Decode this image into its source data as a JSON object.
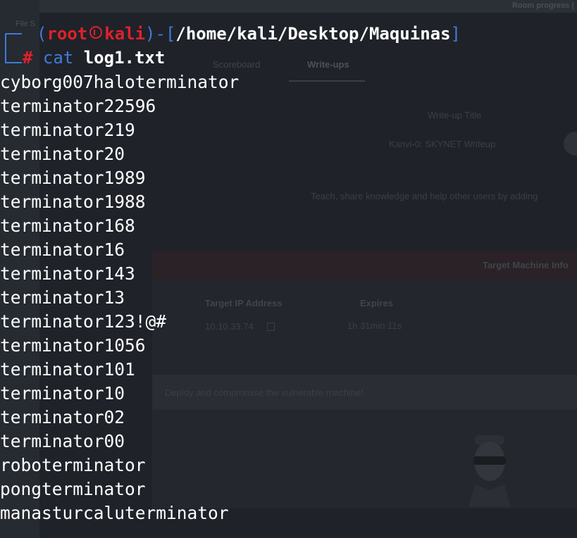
{
  "background": {
    "topbar_text": "Room progress (",
    "file_label": "File S",
    "tabs": [
      "Scoreboard",
      "Write-ups"
    ],
    "writeup_title_label": "Write-up Title",
    "writeup_title_value": "Kanvi-0: SKYNET Writeup",
    "teach_text": "Teach, share knowledge and help other users by adding",
    "target_title": "Target Machine Info",
    "ip_label": "Target IP Address",
    "ip_value": "10.10.33.74",
    "expires_label": "Expires",
    "expires_value": "1h 31min 11s",
    "deploy_text": "Deploy and compromise the vulnerable machine!"
  },
  "terminal": {
    "prompt_open": "┌──(",
    "user": "root",
    "host": "kali",
    "prompt_sep": ")-[",
    "cwd": "/home/kali/Desktop/Maquinas",
    "prompt_close": "]",
    "prompt_hash": "#",
    "command": "cat",
    "argument": "log1.txt",
    "colors": {
      "prompt": "#3f7bd9",
      "user": "#e0212b",
      "text": "#ffffff",
      "background": "#1f2229"
    },
    "icon": "kali-dragon-icon",
    "output": [
      "cyborg007haloterminator",
      "terminator22596",
      "terminator219",
      "terminator20",
      "terminator1989",
      "terminator1988",
      "terminator168",
      "terminator16",
      "terminator143",
      "terminator13",
      "terminator123!@#",
      "terminator1056",
      "terminator101",
      "terminator10",
      "terminator02",
      "terminator00",
      "roboterminator",
      "pongterminator",
      "manasturcaluterminator"
    ]
  }
}
